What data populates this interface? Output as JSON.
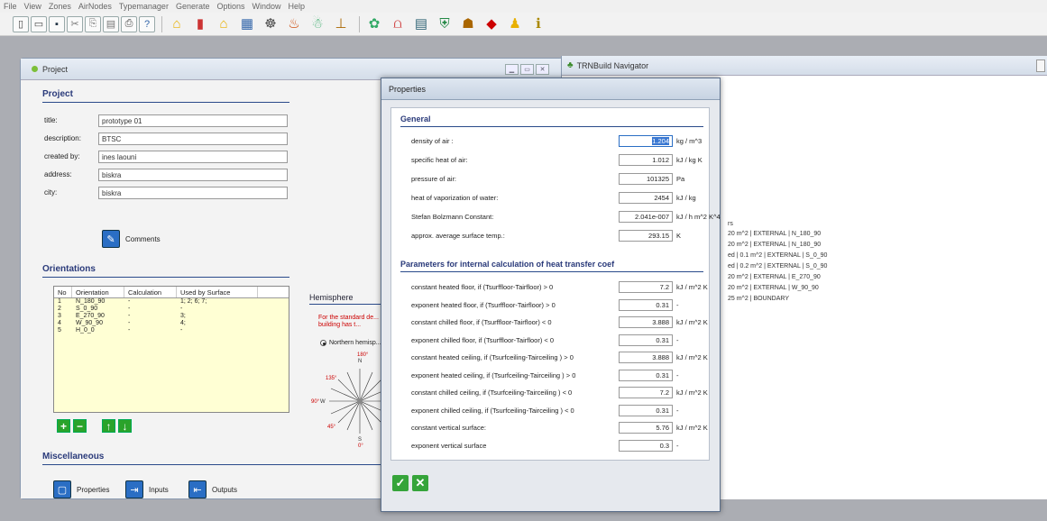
{
  "menu": [
    "File",
    "View",
    "Zones",
    "AirNodes",
    "Typemanager",
    "Generate",
    "Options",
    "Window",
    "Help"
  ],
  "colors": {
    "accent_blue": "#2a6ec4",
    "section_navy": "#2a3a7a",
    "warning_red": "#cc0000",
    "button_green": "#2aa32a"
  },
  "toolbar": {
    "icons": [
      "new-icon",
      "open-icon",
      "save-icon",
      "cut-icon",
      "copy-icon",
      "paste-icon",
      "print-icon",
      "help-icon",
      "house-icon",
      "chart-icon",
      "building-icon",
      "grid-icon",
      "people-icon",
      "fire-icon",
      "snowman-icon",
      "heater-icon",
      "plant-icon",
      "wave-icon",
      "panel-icon",
      "shield-icon",
      "hat-icon",
      "cube-icon",
      "person-icon",
      "info-icon"
    ],
    "glyphs": [
      "▯",
      "▭",
      "▪",
      "✂",
      "⎘",
      "▤",
      "⎙",
      "?",
      "⌂",
      "▮",
      "⌂",
      "▦",
      "☸",
      "♨",
      "☃",
      "⊥",
      "✿",
      "⩍",
      "▤",
      "⛨",
      "☗",
      "◆",
      "♟",
      "ℹ"
    ]
  },
  "project": {
    "window_title": "Project",
    "section_title": "Project",
    "fields": [
      {
        "label": "title:",
        "value": "prototype 01"
      },
      {
        "label": "description:",
        "value": "BTSC"
      },
      {
        "label": "created by:",
        "value": "ines laouni"
      },
      {
        "label": "address:",
        "value": "biskra"
      },
      {
        "label": "city:",
        "value": "biskra"
      }
    ],
    "comments_label": "Comments",
    "orientations_title": "Orientations",
    "table": {
      "headers": [
        "No",
        "Orientation",
        "Calculation",
        "Used by Surface"
      ],
      "rows": [
        [
          "1",
          "N_180_90",
          "-",
          "1; 2; 6; 7;"
        ],
        [
          "2",
          "S_0_90",
          "-",
          "-"
        ],
        [
          "3",
          "E_270_90",
          "-",
          "3;"
        ],
        [
          "4",
          "W_90_90",
          "-",
          "4;"
        ],
        [
          "5",
          "H_0_0",
          "-",
          "-"
        ]
      ]
    },
    "hemisphere": {
      "title": "Hemisphere",
      "note": "For the standard de... of the building has t...",
      "option": "Northern hemisp...",
      "compass_labels": {
        "n_deg": "180°",
        "n": "N",
        "nw": "135°",
        "w": "W",
        "w_deg": "90°",
        "sw": "45°",
        "s": "S",
        "s_deg": "0°"
      }
    },
    "misc_title": "Miscellaneous",
    "misc_buttons": {
      "properties": "Properties",
      "inputs": "Inputs",
      "outputs": "Outputs"
    }
  },
  "navigator": {
    "title": "TRNBuild Navigator",
    "header_fragment": "rs",
    "lines": [
      "20 m^2 | EXTERNAL | N_180_90",
      "20 m^2 | EXTERNAL | N_180_90",
      "ed | 0.1 m^2 | EXTERNAL | S_0_90",
      "ed | 0.2 m^2 | EXTERNAL | S_0_90",
      "20 m^2 | EXTERNAL | E_270_90",
      "20 m^2 | EXTERNAL | W_90_90",
      "25 m^2 | BOUNDARY"
    ]
  },
  "properties": {
    "title": "Properties",
    "general_title": "General",
    "general": [
      {
        "label": "density of air :",
        "value": "1.204",
        "unit": "kg / m^3"
      },
      {
        "label": "specific heat of air:",
        "value": "1.012",
        "unit": "kJ / kg K"
      },
      {
        "label": "pressure of air:",
        "value": "101325",
        "unit": "Pa"
      },
      {
        "label": "heat of vaporization of water:",
        "value": "2454",
        "unit": "kJ / kg"
      },
      {
        "label": "Stefan Bolzmann Constant:",
        "value": "2.041e-007",
        "unit": "kJ / h m^2 K^4"
      },
      {
        "label": "approx. average surface temp.:",
        "value": "293.15",
        "unit": "K"
      }
    ],
    "params_title": "Parameters for internal calculation of heat transfer coef",
    "params": [
      {
        "label": "constant heated floor,  if  (Tsurffloor-Tairfloor) > 0",
        "value": "7.2",
        "unit": "kJ / m^2 K"
      },
      {
        "label": "exponent heated floor,  if  (Tsurffloor-Tairfloor) > 0",
        "value": "0.31",
        "unit": "-"
      },
      {
        "label": "constant chilled floor,  if  (Tsurffloor-Tairfloor) < 0",
        "value": "3.888",
        "unit": "kJ / m^2 K"
      },
      {
        "label": "exponent chilled floor,  if  (Tsurffloor-Tairfloor) < 0",
        "value": "0.31",
        "unit": "-"
      },
      {
        "label": "constant heated ceiling,  if  (Tsurfceiling-Tairceiling ) > 0",
        "value": "3.888",
        "unit": "kJ / m^2 K"
      },
      {
        "label": "exponent heated ceiling,  if  (Tsurfceiling-Tairceiling ) > 0",
        "value": "0.31",
        "unit": "-"
      },
      {
        "label": "constant chilled ceiling,  if  (Tsurfceiling-Tairceiling )  < 0",
        "value": "7.2",
        "unit": "kJ / m^2 K"
      },
      {
        "label": "exponent chilled ceiling,  if  (Tsurfceiling-Tairceiling ) < 0",
        "value": "0.31",
        "unit": "-"
      },
      {
        "label": "constant vertical surface:",
        "value": "5.76",
        "unit": "kJ / m^2 K"
      },
      {
        "label": "exponent vertical surface",
        "value": "0.3",
        "unit": "-"
      }
    ]
  }
}
